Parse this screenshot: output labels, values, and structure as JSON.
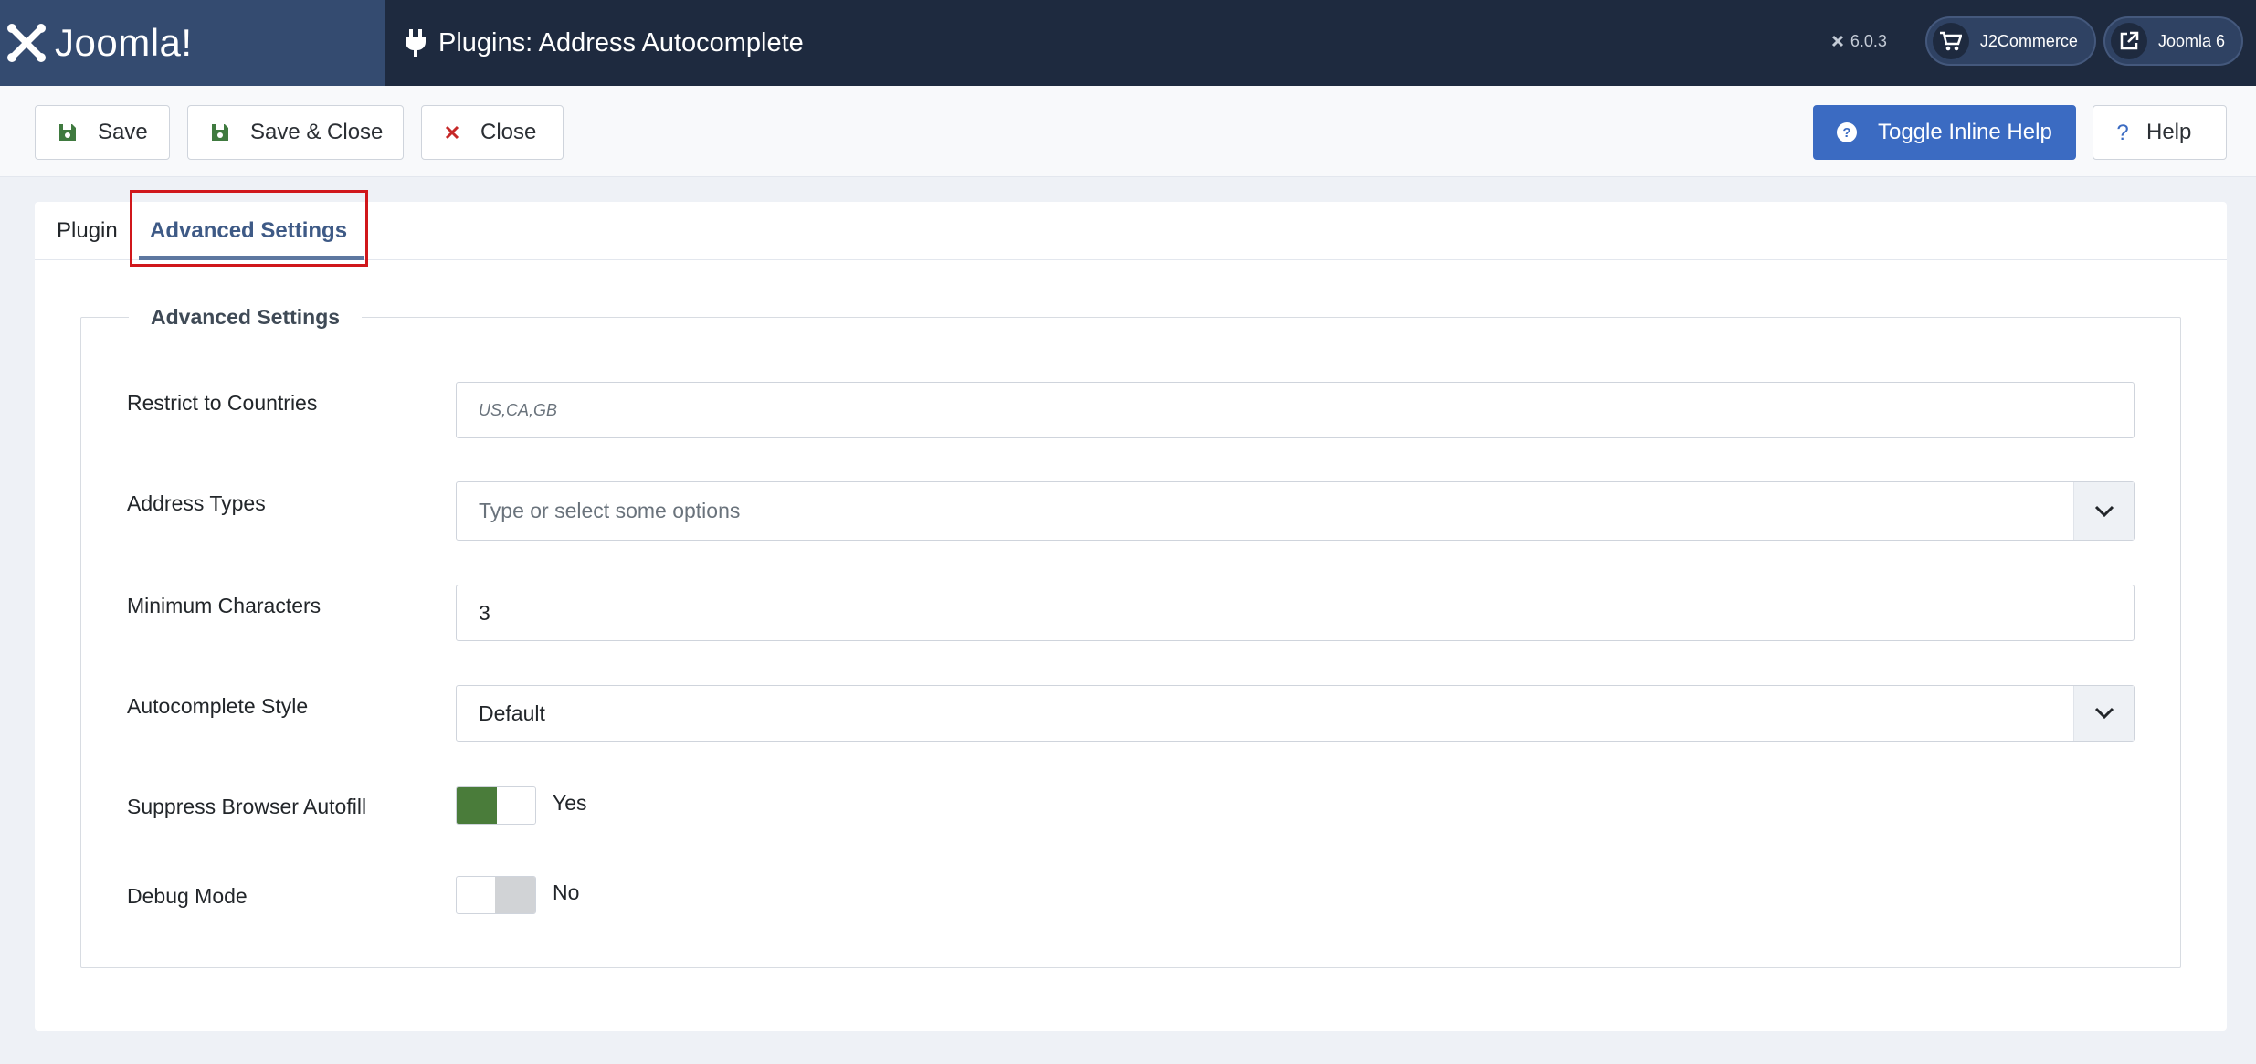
{
  "header": {
    "brand": "Joomla!",
    "page_title": "Plugins: Address Autocomplete",
    "version": "6.0.3",
    "links": [
      {
        "label": "J2Commerce",
        "icon": "cart-icon"
      },
      {
        "label": "Joomla 6",
        "icon": "external-link-icon"
      }
    ]
  },
  "toolbar": {
    "save": "Save",
    "save_close": "Save & Close",
    "close": "Close",
    "toggle_help": "Toggle Inline Help",
    "help": "Help"
  },
  "tabs": [
    {
      "label": "Plugin",
      "active": false
    },
    {
      "label": "Advanced Settings",
      "active": true
    }
  ],
  "fieldset": {
    "legend": "Advanced Settings",
    "fields": {
      "restrict_countries": {
        "label": "Restrict to Countries",
        "placeholder": "US,CA,GB"
      },
      "address_types": {
        "label": "Address Types",
        "placeholder": "Type or select some options"
      },
      "min_chars": {
        "label": "Minimum Characters",
        "value": "3"
      },
      "style": {
        "label": "Autocomplete Style",
        "value": "Default"
      },
      "suppress_autofill": {
        "label": "Suppress Browser Autofill",
        "state": "Yes"
      },
      "debug": {
        "label": "Debug Mode",
        "state": "No"
      }
    }
  },
  "colors": {
    "header_bg": "#1e2a3f",
    "brand_bg": "#344b70",
    "primary": "#3b6bc2",
    "toggle_on": "#4a7c3a",
    "highlight": "#d0171b"
  }
}
